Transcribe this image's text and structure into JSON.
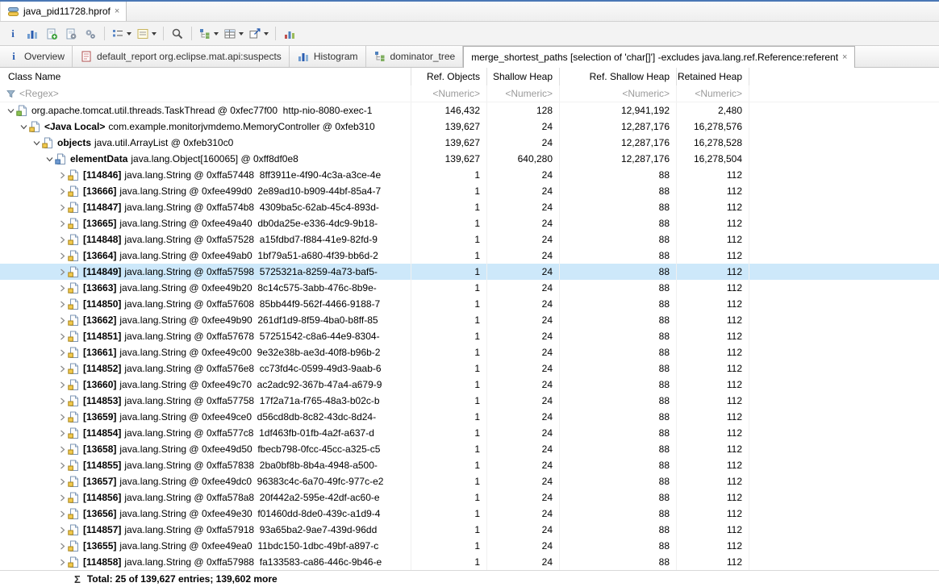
{
  "editor": {
    "tab_label": "java_pid11728.hprof",
    "close_glyph": "×"
  },
  "toolbar": {
    "buttons": [
      {
        "name": "info-icon",
        "glyph": "info"
      },
      {
        "name": "histogram-icon",
        "glyph": "bars"
      },
      {
        "name": "create-report-icon",
        "glyph": "page-plus"
      },
      {
        "name": "run-expert-report-icon",
        "glyph": "page-gear"
      },
      {
        "name": "gears-icon",
        "glyph": "gears"
      },
      {
        "name": "sep"
      },
      {
        "name": "grouping-dropdown",
        "glyph": "list",
        "dropdown": true
      },
      {
        "name": "calculate-retained-dropdown",
        "glyph": "tasks",
        "dropdown": true
      },
      {
        "name": "sep"
      },
      {
        "name": "search-icon",
        "glyph": "magnifier"
      },
      {
        "name": "sep"
      },
      {
        "name": "thread-view-dropdown",
        "glyph": "tree",
        "dropdown": true
      },
      {
        "name": "customize-table-dropdown",
        "glyph": "grid",
        "dropdown": true
      },
      {
        "name": "export-dropdown",
        "glyph": "export",
        "dropdown": true
      },
      {
        "name": "sep"
      },
      {
        "name": "statistics-icon",
        "glyph": "chart"
      }
    ]
  },
  "tabs": [
    {
      "label": "Overview",
      "icon": "info",
      "active": false,
      "closable": false
    },
    {
      "label": "default_report org.eclipse.mat.api:suspects",
      "icon": "report",
      "active": false,
      "closable": false
    },
    {
      "label": "Histogram",
      "icon": "bars",
      "active": false,
      "closable": false
    },
    {
      "label": "dominator_tree",
      "icon": "tree",
      "active": false,
      "closable": false
    },
    {
      "label": "merge_shortest_paths [selection of 'char[]'] -excludes java.lang.ref.Reference:referent",
      "icon": null,
      "active": true,
      "closable": true,
      "close_glyph": "×"
    }
  ],
  "table": {
    "columns": [
      "Class Name",
      "Ref. Objects",
      "Shallow Heap",
      "Ref. Shallow Heap",
      "Retained Heap"
    ],
    "filters": [
      "<Regex>",
      "<Numeric>",
      "<Numeric>",
      "<Numeric>",
      "<Numeric>"
    ],
    "total_glyph": "Σ",
    "total_label": "Total: 25 of 139,627 entries; 139,602 more",
    "rows": [
      {
        "depth": 0,
        "expanded": true,
        "icon": "thread",
        "prefix": "",
        "text": "org.apache.tomcat.util.threads.TaskThread @ 0xfec77f00  http-nio-8080-exec-1",
        "values": [
          "146,432",
          "128",
          "12,941,192",
          "2,480"
        ],
        "selected": false
      },
      {
        "depth": 1,
        "expanded": true,
        "icon": "local",
        "prefix": "<Java Local>",
        "text": "com.example.monitorjvmdemo.MemoryController @ 0xfeb310",
        "values": [
          "139,627",
          "24",
          "12,287,176",
          "16,278,576"
        ],
        "selected": false
      },
      {
        "depth": 2,
        "expanded": true,
        "icon": "field",
        "prefix": "objects",
        "text": "java.util.ArrayList @ 0xfeb310c0",
        "values": [
          "139,627",
          "24",
          "12,287,176",
          "16,278,528"
        ],
        "selected": false
      },
      {
        "depth": 3,
        "expanded": true,
        "icon": "array",
        "prefix": "elementData",
        "text": "java.lang.Object[160065] @ 0xff8df0e8",
        "values": [
          "139,627",
          "640,280",
          "12,287,176",
          "16,278,504"
        ],
        "selected": false
      },
      {
        "depth": 4,
        "expanded": false,
        "icon": "string",
        "prefix": "[114846]",
        "text": "java.lang.String @ 0xffa57448  8ff3911e-4f90-4c3a-a3ce-4e",
        "values": [
          "1",
          "24",
          "88",
          "112"
        ],
        "selected": false
      },
      {
        "depth": 4,
        "expanded": false,
        "icon": "string",
        "prefix": "[13666]",
        "text": "java.lang.String @ 0xfee499d0  2e89ad10-b909-44bf-85a4-7",
        "values": [
          "1",
          "24",
          "88",
          "112"
        ],
        "selected": false
      },
      {
        "depth": 4,
        "expanded": false,
        "icon": "string",
        "prefix": "[114847]",
        "text": "java.lang.String @ 0xffa574b8  4309ba5c-62ab-45c4-893d-",
        "values": [
          "1",
          "24",
          "88",
          "112"
        ],
        "selected": false
      },
      {
        "depth": 4,
        "expanded": false,
        "icon": "string",
        "prefix": "[13665]",
        "text": "java.lang.String @ 0xfee49a40  db0da25e-e336-4dc9-9b18-",
        "values": [
          "1",
          "24",
          "88",
          "112"
        ],
        "selected": false
      },
      {
        "depth": 4,
        "expanded": false,
        "icon": "string",
        "prefix": "[114848]",
        "text": "java.lang.String @ 0xffa57528  a15fdbd7-f884-41e9-82fd-9",
        "values": [
          "1",
          "24",
          "88",
          "112"
        ],
        "selected": false
      },
      {
        "depth": 4,
        "expanded": false,
        "icon": "string",
        "prefix": "[13664]",
        "text": "java.lang.String @ 0xfee49ab0  1bf79a51-a680-4f39-bb6d-2",
        "values": [
          "1",
          "24",
          "88",
          "112"
        ],
        "selected": false
      },
      {
        "depth": 4,
        "expanded": false,
        "icon": "string",
        "prefix": "[114849]",
        "text": "java.lang.String @ 0xffa57598  5725321a-8259-4a73-baf5-",
        "values": [
          "1",
          "24",
          "88",
          "112"
        ],
        "selected": true
      },
      {
        "depth": 4,
        "expanded": false,
        "icon": "string",
        "prefix": "[13663]",
        "text": "java.lang.String @ 0xfee49b20  8c14c575-3abb-476c-8b9e-",
        "values": [
          "1",
          "24",
          "88",
          "112"
        ],
        "selected": false
      },
      {
        "depth": 4,
        "expanded": false,
        "icon": "string",
        "prefix": "[114850]",
        "text": "java.lang.String @ 0xffa57608  85bb44f9-562f-4466-9188-7",
        "values": [
          "1",
          "24",
          "88",
          "112"
        ],
        "selected": false
      },
      {
        "depth": 4,
        "expanded": false,
        "icon": "string",
        "prefix": "[13662]",
        "text": "java.lang.String @ 0xfee49b90  261df1d9-8f59-4ba0-b8ff-85",
        "values": [
          "1",
          "24",
          "88",
          "112"
        ],
        "selected": false
      },
      {
        "depth": 4,
        "expanded": false,
        "icon": "string",
        "prefix": "[114851]",
        "text": "java.lang.String @ 0xffa57678  57251542-c8a6-44e9-8304-",
        "values": [
          "1",
          "24",
          "88",
          "112"
        ],
        "selected": false
      },
      {
        "depth": 4,
        "expanded": false,
        "icon": "string",
        "prefix": "[13661]",
        "text": "java.lang.String @ 0xfee49c00  9e32e38b-ae3d-40f8-b96b-2",
        "values": [
          "1",
          "24",
          "88",
          "112"
        ],
        "selected": false
      },
      {
        "depth": 4,
        "expanded": false,
        "icon": "string",
        "prefix": "[114852]",
        "text": "java.lang.String @ 0xffa576e8  cc73fd4c-0599-49d3-9aab-6",
        "values": [
          "1",
          "24",
          "88",
          "112"
        ],
        "selected": false
      },
      {
        "depth": 4,
        "expanded": false,
        "icon": "string",
        "prefix": "[13660]",
        "text": "java.lang.String @ 0xfee49c70  ac2adc92-367b-47a4-a679-9",
        "values": [
          "1",
          "24",
          "88",
          "112"
        ],
        "selected": false
      },
      {
        "depth": 4,
        "expanded": false,
        "icon": "string",
        "prefix": "[114853]",
        "text": "java.lang.String @ 0xffa57758  17f2a71a-f765-48a3-b02c-b",
        "values": [
          "1",
          "24",
          "88",
          "112"
        ],
        "selected": false
      },
      {
        "depth": 4,
        "expanded": false,
        "icon": "string",
        "prefix": "[13659]",
        "text": "java.lang.String @ 0xfee49ce0  d56cd8db-8c82-43dc-8d24-",
        "values": [
          "1",
          "24",
          "88",
          "112"
        ],
        "selected": false
      },
      {
        "depth": 4,
        "expanded": false,
        "icon": "string",
        "prefix": "[114854]",
        "text": "java.lang.String @ 0xffa577c8  1df463fb-01fb-4a2f-a637-d",
        "values": [
          "1",
          "24",
          "88",
          "112"
        ],
        "selected": false
      },
      {
        "depth": 4,
        "expanded": false,
        "icon": "string",
        "prefix": "[13658]",
        "text": "java.lang.String @ 0xfee49d50  fbecb798-0fcc-45cc-a325-c5",
        "values": [
          "1",
          "24",
          "88",
          "112"
        ],
        "selected": false
      },
      {
        "depth": 4,
        "expanded": false,
        "icon": "string",
        "prefix": "[114855]",
        "text": "java.lang.String @ 0xffa57838  2ba0bf8b-8b4a-4948-a500-",
        "values": [
          "1",
          "24",
          "88",
          "112"
        ],
        "selected": false
      },
      {
        "depth": 4,
        "expanded": false,
        "icon": "string",
        "prefix": "[13657]",
        "text": "java.lang.String @ 0xfee49dc0  96383c4c-6a70-49fc-977c-e2",
        "values": [
          "1",
          "24",
          "88",
          "112"
        ],
        "selected": false
      },
      {
        "depth": 4,
        "expanded": false,
        "icon": "string",
        "prefix": "[114856]",
        "text": "java.lang.String @ 0xffa578a8  20f442a2-595e-42df-ac60-e",
        "values": [
          "1",
          "24",
          "88",
          "112"
        ],
        "selected": false
      },
      {
        "depth": 4,
        "expanded": false,
        "icon": "string",
        "prefix": "[13656]",
        "text": "java.lang.String @ 0xfee49e30  f01460dd-8de0-439c-a1d9-4",
        "values": [
          "1",
          "24",
          "88",
          "112"
        ],
        "selected": false
      },
      {
        "depth": 4,
        "expanded": false,
        "icon": "string",
        "prefix": "[114857]",
        "text": "java.lang.String @ 0xffa57918  93a65ba2-9ae7-439d-96dd",
        "values": [
          "1",
          "24",
          "88",
          "112"
        ],
        "selected": false
      },
      {
        "depth": 4,
        "expanded": false,
        "icon": "string",
        "prefix": "[13655]",
        "text": "java.lang.String @ 0xfee49ea0  11bdc150-1dbc-49bf-a897-c",
        "values": [
          "1",
          "24",
          "88",
          "112"
        ],
        "selected": false
      },
      {
        "depth": 4,
        "expanded": false,
        "icon": "string",
        "prefix": "[114858]",
        "text": "java.lang.String @ 0xffa57988  fa133583-ca86-446c-9b46-e",
        "values": [
          "1",
          "24",
          "88",
          "112"
        ],
        "selected": false
      }
    ]
  }
}
